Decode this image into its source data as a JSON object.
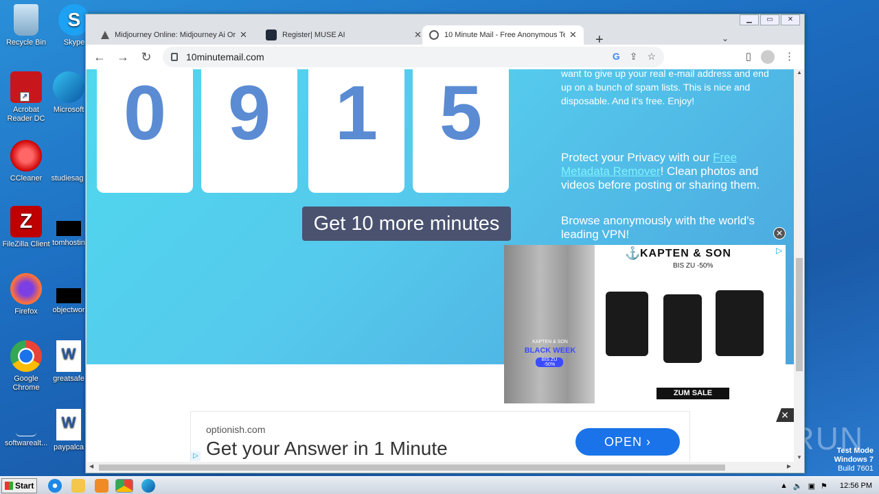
{
  "desktop": {
    "icons": [
      {
        "label": "Recycle Bin"
      },
      {
        "label": "Skype"
      },
      {
        "label": "Acrobat Reader DC"
      },
      {
        "label": "Microsoft"
      },
      {
        "label": "CCleaner"
      },
      {
        "label": "studiesag"
      },
      {
        "label": "FileZilla Client"
      },
      {
        "label": "tomhostin"
      },
      {
        "label": "Firefox"
      },
      {
        "label": "objectwor"
      },
      {
        "label": "Google Chrome"
      },
      {
        "label": "greatsafe"
      },
      {
        "label": "softwarealt..."
      },
      {
        "label": "paypalca"
      }
    ],
    "watermark": {
      "line1": "Test Mode",
      "line2": "Windows 7",
      "line3": "Build 7601"
    },
    "anyrun": "ANY RUN"
  },
  "browser": {
    "tabs": [
      {
        "title": "Midjourney Online: Midjourney Ai Or",
        "icon": "sailboat-icon"
      },
      {
        "title": "Register| MUSE AI",
        "icon": "muse-icon"
      },
      {
        "title": "10 Minute Mail - Free Anonymous Te",
        "icon": "globe-icon"
      }
    ],
    "url": "10minutemail.com"
  },
  "page": {
    "timer_digits": [
      "0",
      "9",
      "1",
      "5"
    ],
    "more_button": "Get 10 more minutes",
    "side": {
      "para1": "want to give up your real e-mail address and end up on a bunch of spam lists. This is nice and disposable. And it's free. Enjoy!",
      "privacy_prefix": "Protect your Privacy with our ",
      "privacy_link": "Free Metadata Remover",
      "privacy_suffix": "! Clean photos and videos before posting or sharing them.",
      "vpn": "Browse anonymously with the world's leading VPN!"
    }
  },
  "ads": {
    "kapten": {
      "brand": "KAPTEN & SON",
      "sub": "BIS ZU -50%",
      "photo_brand": "KAPTEN & SON",
      "photo_title": "BLACK WEEK",
      "photo_sub": "BIS ZU -50%",
      "cta": "ZUM SALE"
    },
    "bottom": {
      "domain": "optionish.com",
      "headline": "Get your Answer in 1 Minute",
      "button": "OPEN"
    }
  },
  "taskbar": {
    "start": "Start",
    "clock": "12:56 PM"
  }
}
